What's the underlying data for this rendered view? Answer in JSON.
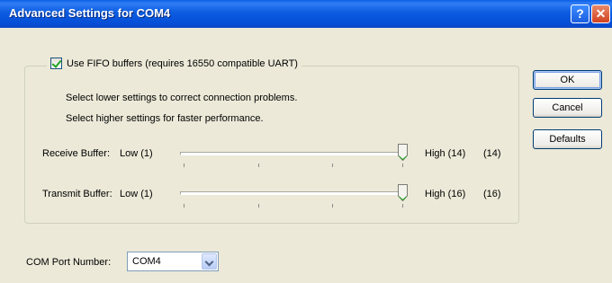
{
  "window": {
    "title": "Advanced Settings for COM4",
    "help_glyph": "?",
    "close_glyph": "✕"
  },
  "fifo": {
    "checkbox_label": "Use FIFO buffers (requires 16550 compatible UART)",
    "checked": true,
    "hint_lower": "Select lower settings to correct connection problems.",
    "hint_higher": "Select higher settings for faster performance."
  },
  "receive": {
    "label": "Receive Buffer:",
    "low_label": "Low (1)",
    "high_label": "High (14)",
    "current": "(14)",
    "level_fraction": 1.0
  },
  "transmit": {
    "label": "Transmit Buffer:",
    "low_label": "Low (1)",
    "high_label": "High (16)",
    "current": "(16)",
    "level_fraction": 1.0
  },
  "buttons": {
    "ok": "OK",
    "cancel": "Cancel",
    "defaults": "Defaults"
  },
  "com_port": {
    "label": "COM Port Number:",
    "selected": "COM4"
  }
}
